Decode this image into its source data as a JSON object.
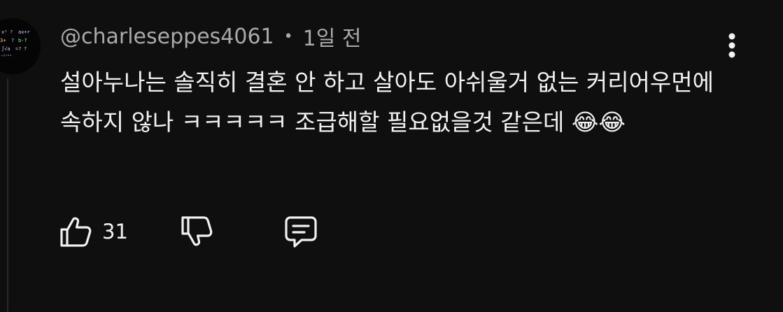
{
  "comment": {
    "author": "@charleseppes4061",
    "separator": "•",
    "timestamp": "1일 전",
    "text": "설아누나는 솔직히 결혼 안 하고 살아도 아쉬울거 없는 커리어우먼에 속하지 않나 ㅋㅋㅋㅋㅋ 조급해할 필요없을것 같은데 😂😂",
    "like_count": "31"
  },
  "icons": {
    "avatar": "avatar-math-doodle",
    "more": "more-vertical-icon",
    "like": "thumbs-up-icon",
    "dislike": "thumbs-down-icon",
    "reply": "comment-icon"
  },
  "colors": {
    "background": "#0f0f0f",
    "primary_text": "#f1f1f1",
    "secondary_text": "#aaaaaa"
  }
}
